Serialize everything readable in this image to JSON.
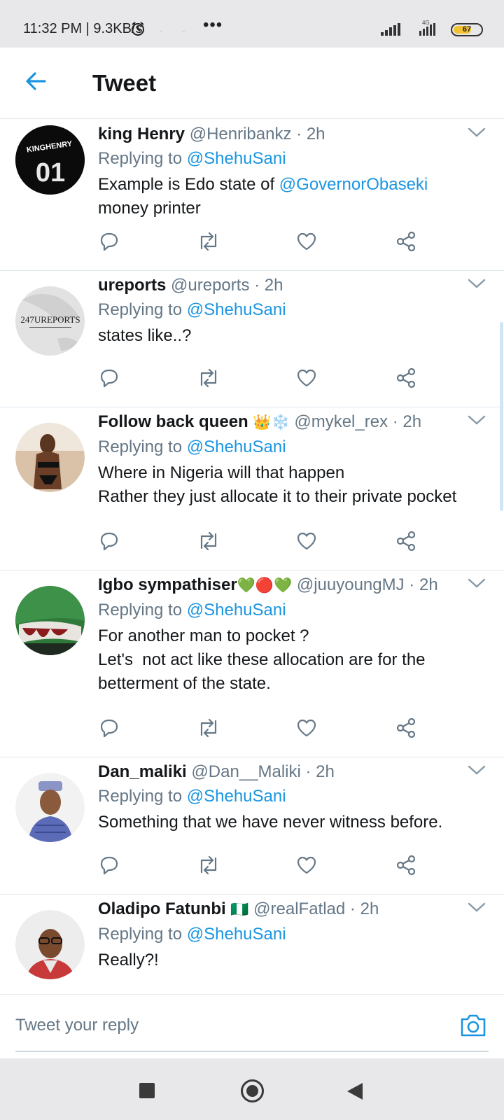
{
  "status_bar": {
    "time": "11:32 PM | 9.3KB/s",
    "more": "•••",
    "network": "4G",
    "battery": "67",
    "battery_level": 0.67
  },
  "header": {
    "title": "Tweet"
  },
  "icons": {
    "back": "arrow-left-icon",
    "reply": "reply-icon",
    "retweet": "retweet-icon",
    "like": "heart-icon",
    "share": "share-icon",
    "chevron": "chevron-down-icon",
    "camera": "camera-icon"
  },
  "colors": {
    "accent": "#1b95e0",
    "secondary_text": "#657786",
    "divider": "#e1e8ed"
  },
  "tweets": [
    {
      "name": "king Henry",
      "handle": "@Henribankz",
      "time": "2h",
      "replying_prefix": "Replying to",
      "replying_to": "@ShehuSani",
      "text_before": "Example is Edo state of ",
      "text_mention": "@GovernorObaseki",
      "text_after": " money printer",
      "avatar_text": "KINGHENRY 01"
    },
    {
      "name": "ureports",
      "handle": "@ureports",
      "time": "2h",
      "replying_prefix": "Replying to",
      "replying_to": "@ShehuSani",
      "text_line1": "states like..?",
      "avatar_text": "247UREPORTS"
    },
    {
      "name": "Follow back queen",
      "name_emoji": "👑❄️",
      "handle": "@mykel_rex",
      "time": "2h",
      "replying_prefix": "Replying to",
      "replying_to": "@ShehuSani",
      "text_line1": "Where in Nigeria will that happen",
      "text_line2": "Rather they just allocate it to their private pocket"
    },
    {
      "name": "Igbo sympathiser",
      "name_emoji": "💚🔴💚",
      "handle": "@juuyoungMJ",
      "time": "2h",
      "replying_prefix": "Replying to",
      "replying_to": "@ShehuSani",
      "text_line1": "For another man to pocket ?",
      "text_line2": "Let's  not act like these allocation are for the betterment of the state."
    },
    {
      "name": "Dan_maliki",
      "handle": "@Dan__Maliki",
      "time": "2h",
      "replying_prefix": "Replying to",
      "replying_to": "@ShehuSani",
      "text_line1": "Something that we have never witness before."
    },
    {
      "name": "Oladipo Fatunbi",
      "name_emoji": "🇳🇬",
      "handle": "@realFatlad",
      "time": "2h",
      "replying_prefix": "Replying to",
      "replying_to": "@ShehuSani",
      "text_line1": "Really?!"
    }
  ],
  "reply_box": {
    "placeholder": "Tweet your reply"
  }
}
